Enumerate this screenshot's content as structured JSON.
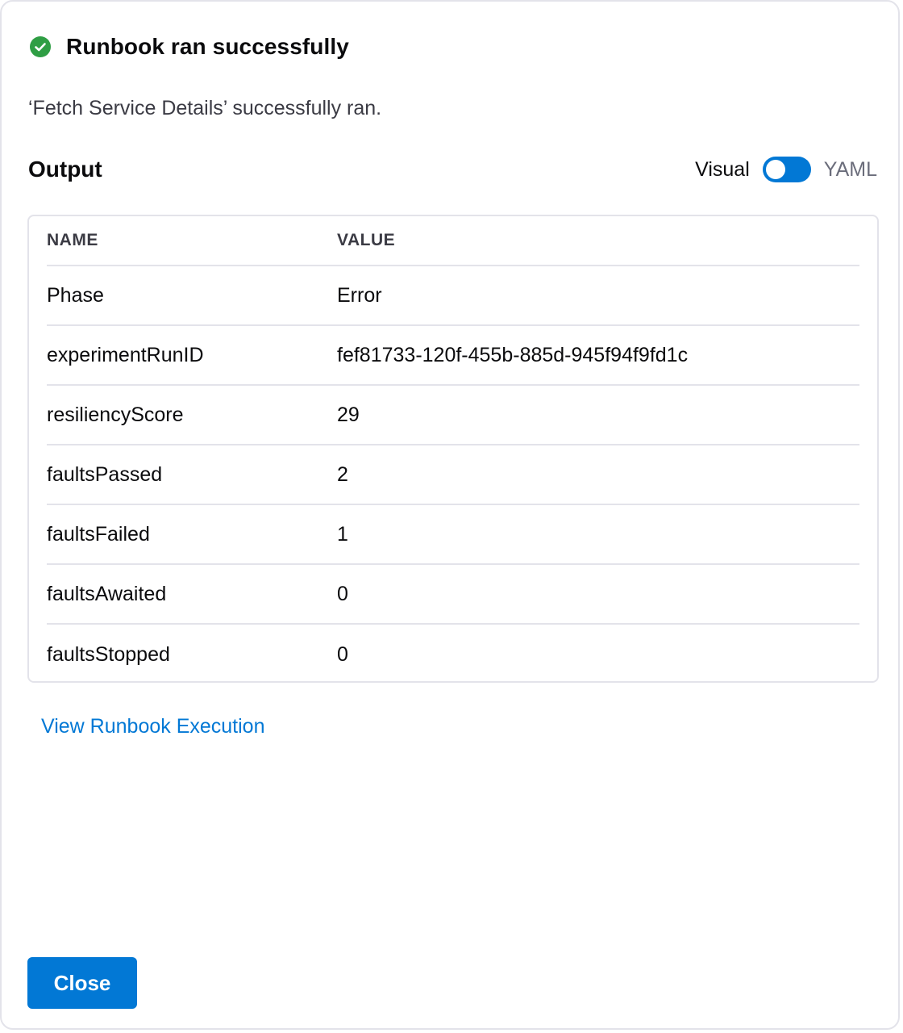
{
  "header": {
    "title": "Runbook ran successfully",
    "status_color": "#2f9e44"
  },
  "subtitle": "‘Fetch Service Details’ successfully ran.",
  "output": {
    "title": "Output",
    "toggle": {
      "left_label": "Visual",
      "right_label": "YAML",
      "accent": "#0278d5"
    }
  },
  "table": {
    "columns": [
      "NAME",
      "VALUE"
    ],
    "rows": [
      {
        "name": "Phase",
        "value": "Error"
      },
      {
        "name": "experimentRunID",
        "value": "fef81733-120f-455b-885d-945f94f9fd1c"
      },
      {
        "name": "resiliencyScore",
        "value": "29"
      },
      {
        "name": "faultsPassed",
        "value": "2"
      },
      {
        "name": "faultsFailed",
        "value": "1"
      },
      {
        "name": "faultsAwaited",
        "value": "0"
      },
      {
        "name": "faultsStopped",
        "value": "0"
      }
    ]
  },
  "link": {
    "label": "View Runbook Execution"
  },
  "footer": {
    "close_label": "Close"
  }
}
